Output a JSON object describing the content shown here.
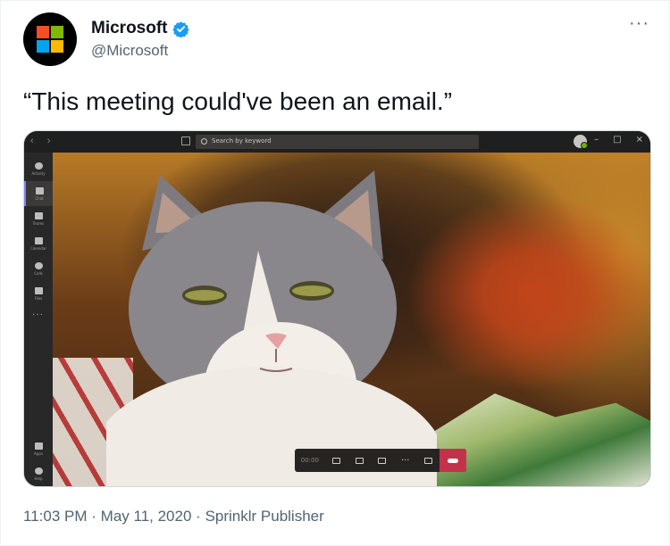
{
  "author": {
    "display_name": "Microsoft",
    "handle": "@Microsoft",
    "verified": true,
    "avatar": "microsoft-logo"
  },
  "more_label": "···",
  "tweet": {
    "text": "“This meeting could've been an email.”"
  },
  "media": {
    "teams": {
      "nav_arrows": "‹ ›",
      "search_placeholder": "Search by keyword",
      "window_buttons": [
        "–",
        "□",
        "×"
      ],
      "rail": [
        {
          "label": "Activity",
          "icon": "bell-icon"
        },
        {
          "label": "Chat",
          "icon": "chat-icon",
          "active": true
        },
        {
          "label": "Teams",
          "icon": "teams-icon"
        },
        {
          "label": "Calendar",
          "icon": "calendar-icon"
        },
        {
          "label": "Calls",
          "icon": "phone-icon"
        },
        {
          "label": "Files",
          "icon": "files-icon"
        }
      ],
      "rail_more": "···",
      "rail_bottom": [
        {
          "label": "Apps",
          "icon": "apps-icon"
        },
        {
          "label": "Help",
          "icon": "help-icon"
        }
      ],
      "call_controls": [
        "timer",
        "camera-icon",
        "mic-icon",
        "share-icon",
        "more-icon",
        "chat-icon",
        "hang-up-icon"
      ],
      "call_more_label": "···",
      "call_timer": "00:00"
    }
  },
  "meta": {
    "time": "11:03 PM",
    "separator": "·",
    "date": "May 11, 2020",
    "source": "Sprinklr Publisher"
  },
  "colors": {
    "ms_red": "#f25022",
    "ms_green": "#7fba00",
    "ms_blue": "#00a4ef",
    "ms_yellow": "#ffb900",
    "verified_blue": "#1d9bf0",
    "hangup_red": "#c4314b"
  }
}
